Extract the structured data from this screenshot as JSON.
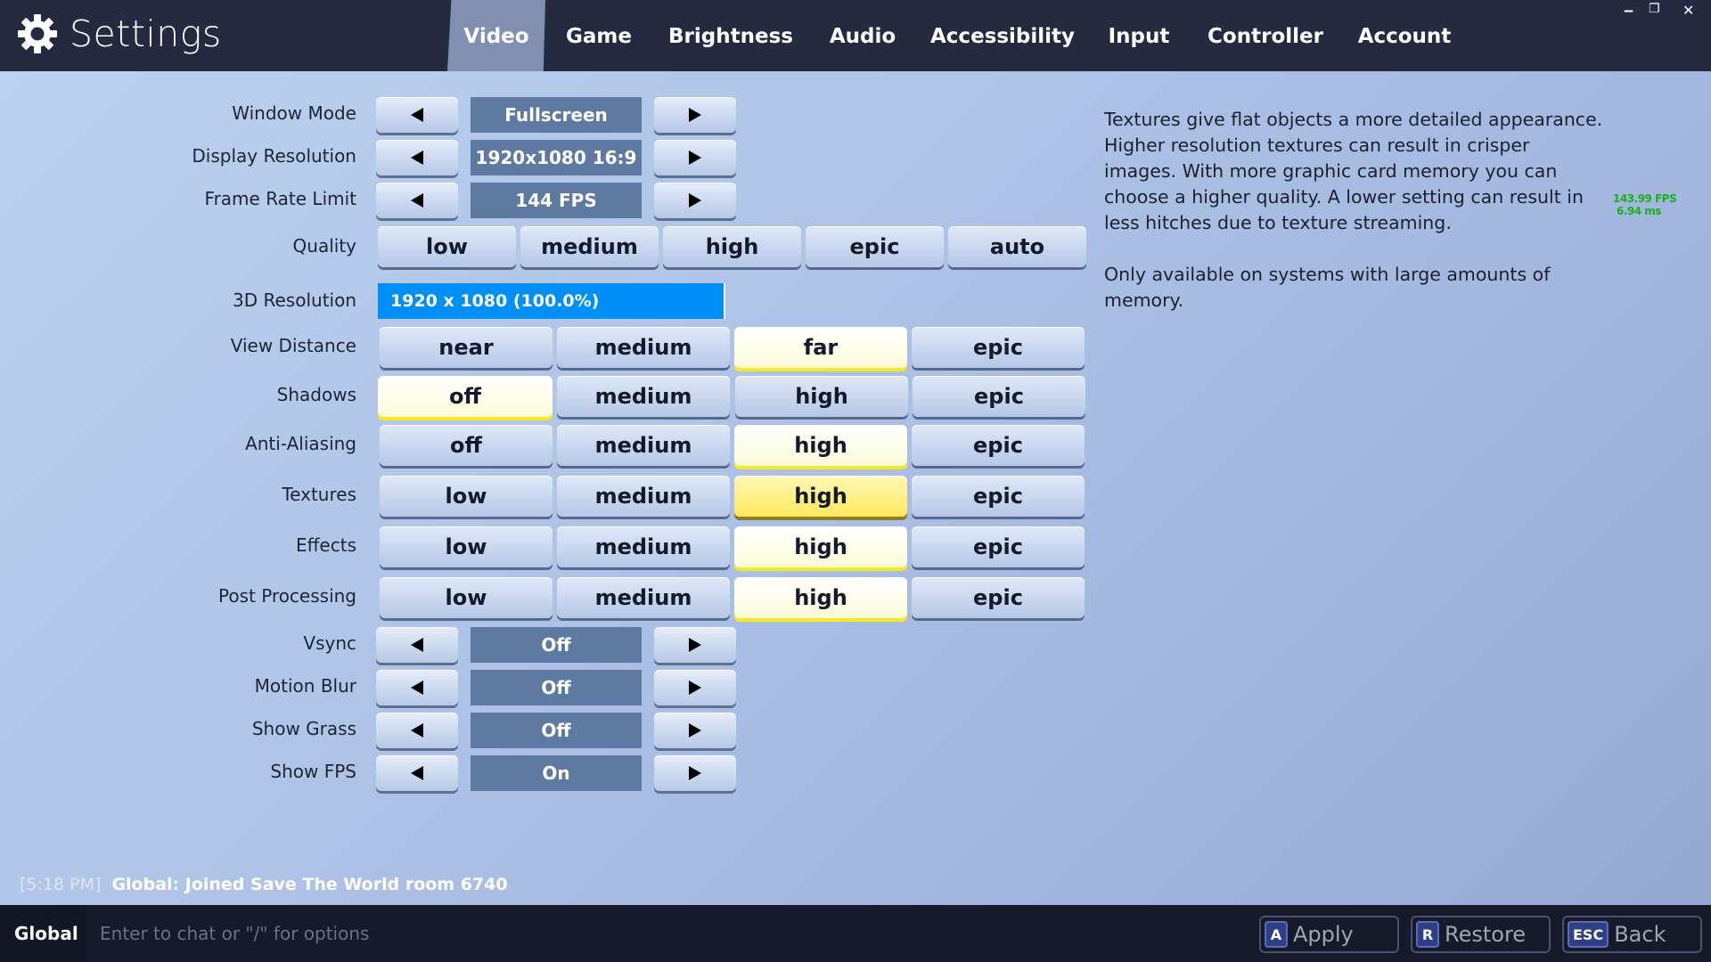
{
  "header": {
    "title": "Settings",
    "tabs": [
      {
        "label": "Video",
        "active": true
      },
      {
        "label": "Game"
      },
      {
        "label": "Brightness"
      },
      {
        "label": "Audio"
      },
      {
        "label": "Accessibility"
      },
      {
        "label": "Input"
      },
      {
        "label": "Controller"
      },
      {
        "label": "Account"
      }
    ],
    "window_controls": {
      "minimize": "‒",
      "restore": "❐",
      "close": "✕"
    }
  },
  "settings": {
    "window_mode": {
      "label": "Window Mode",
      "value": "Fullscreen"
    },
    "display_resolution": {
      "label": "Display Resolution",
      "value": "1920x1080 16:9"
    },
    "frame_rate_limit": {
      "label": "Frame Rate Limit",
      "value": "144 FPS"
    },
    "quality": {
      "label": "Quality",
      "options": [
        "low",
        "medium",
        "high",
        "epic",
        "auto"
      ],
      "selected": null
    },
    "resolution_3d": {
      "label": "3D Resolution",
      "value": "1920 x 1080 (100.0%)",
      "percent": 100.0
    },
    "view_distance": {
      "label": "View Distance",
      "options": [
        "near",
        "medium",
        "far",
        "epic"
      ],
      "selected": "far"
    },
    "shadows": {
      "label": "Shadows",
      "options": [
        "off",
        "medium",
        "high",
        "epic"
      ],
      "selected": "off"
    },
    "anti_aliasing": {
      "label": "Anti-Aliasing",
      "options": [
        "off",
        "medium",
        "high",
        "epic"
      ],
      "selected": "high"
    },
    "textures": {
      "label": "Textures",
      "options": [
        "low",
        "medium",
        "high",
        "epic"
      ],
      "selected": "high",
      "focused": true
    },
    "effects": {
      "label": "Effects",
      "options": [
        "low",
        "medium",
        "high",
        "epic"
      ],
      "selected": "high"
    },
    "post_processing": {
      "label": "Post Processing",
      "options": [
        "low",
        "medium",
        "high",
        "epic"
      ],
      "selected": "high"
    },
    "vsync": {
      "label": "Vsync",
      "value": "Off"
    },
    "motion_blur": {
      "label": "Motion Blur",
      "value": "Off"
    },
    "show_grass": {
      "label": "Show Grass",
      "value": "Off"
    },
    "show_fps": {
      "label": "Show FPS",
      "value": "On"
    }
  },
  "description": {
    "paragraph1": "Textures give flat objects a more detailed appearance. Higher resolution textures can result in crisper images. With more graphic card memory you can choose a higher quality. A lower setting can result in less hitches due to texture streaming.",
    "paragraph2": "Only available on systems with large amounts of memory."
  },
  "fps_counter": {
    "fps": "143.99 FPS",
    "frame_time": "6.94 ms"
  },
  "chat": {
    "time": "[5:18 PM]",
    "message": "Global:  Joined Save The World room 6740",
    "channel": "Global",
    "placeholder": "Enter to chat or \"/\" for options"
  },
  "footer": {
    "apply": {
      "key": "A",
      "label": "Apply"
    },
    "restore": {
      "key": "R",
      "label": "Restore"
    },
    "back": {
      "key": "ESC",
      "label": "Back"
    }
  },
  "colors": {
    "header_bg": "#252a41",
    "active_tab": "#818fb0",
    "value_box": "#5e7aa2",
    "resolution_bar": "#008ef7",
    "selected_accent": "#f5e926",
    "fps_text": "#19b119"
  }
}
